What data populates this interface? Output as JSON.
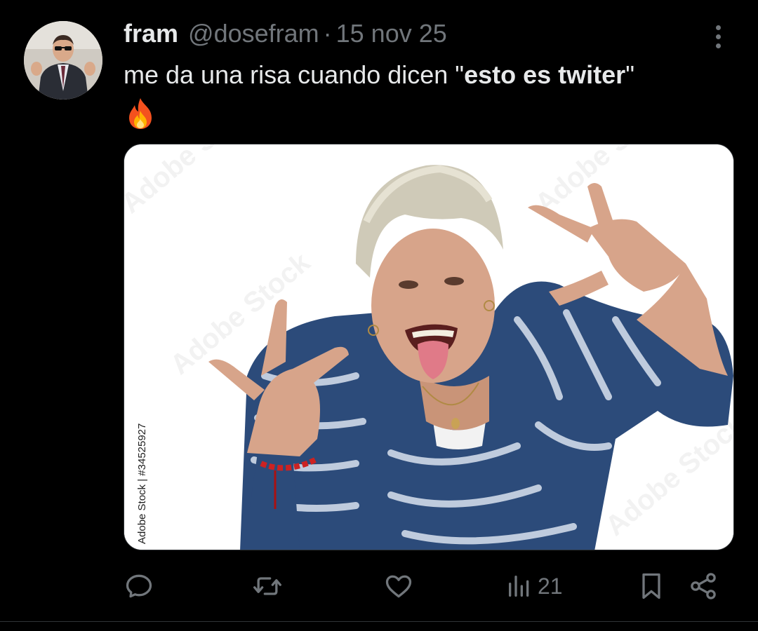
{
  "author": {
    "name": "fram",
    "handle": "@dosefram",
    "separator": "·",
    "date": "15 nov 25"
  },
  "post": {
    "text_plain": "me da una risa cuando dicen \"",
    "text_bold": "esto es twiter",
    "text_end": "\"",
    "emoji": "fire-emoji"
  },
  "media": {
    "watermark_credit": "Adobe Stock | #34525927",
    "watermark_brand": "Adobe Stock"
  },
  "actions": {
    "reply_icon": "reply-icon",
    "repost_icon": "repost-icon",
    "like_icon": "heart-icon",
    "views_icon": "views-icon",
    "views_count": "21",
    "bookmark_icon": "bookmark-icon",
    "share_icon": "share-icon"
  },
  "colors": {
    "background": "#000000",
    "text_primary": "#e7e9ea",
    "text_secondary": "#71767b",
    "border": "#2f3336"
  }
}
